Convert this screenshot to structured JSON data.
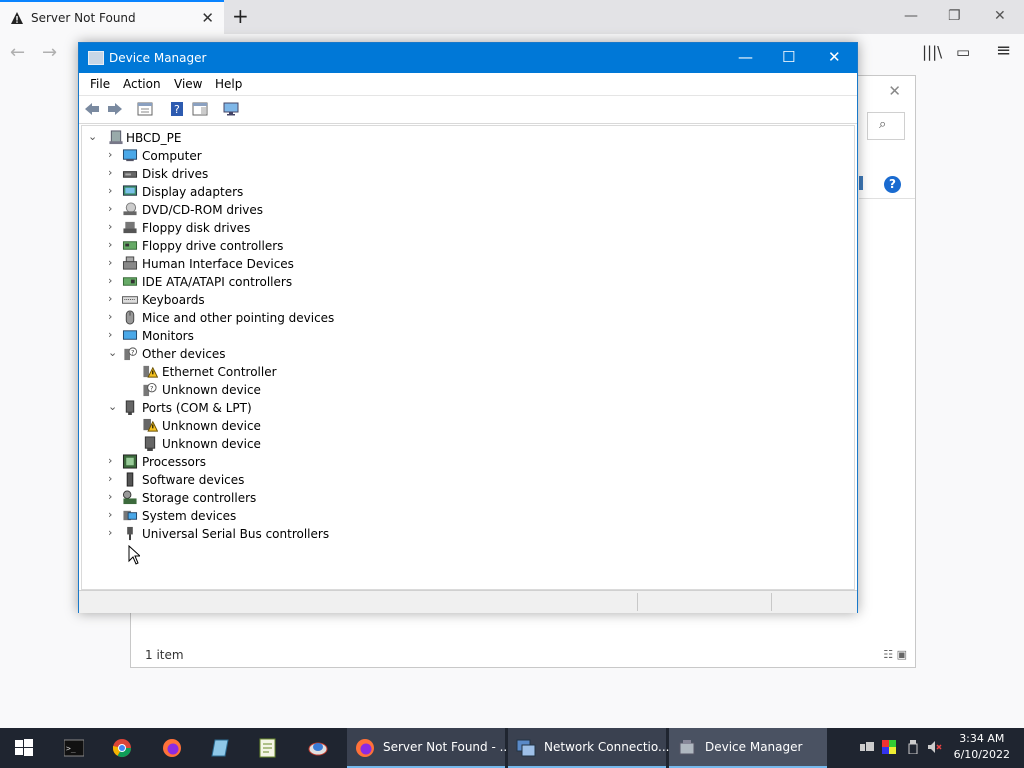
{
  "browser": {
    "tab_title": "Server Not Found",
    "tab_close": "✕",
    "new_tab": "+",
    "window_controls": {
      "minimize": "—",
      "restore": "❐",
      "close": "✕"
    },
    "nav": {
      "back": "←",
      "forward": "→"
    },
    "toolbar": {
      "library": "|||\\",
      "sidebar": "▭",
      "menu": "≡"
    }
  },
  "network_window": {
    "close": "✕",
    "search_icon": "⌕",
    "help": "?",
    "status_text": "1 item",
    "view_buttons": "☷ ▣"
  },
  "device_manager": {
    "title": "Device Manager",
    "controls": {
      "minimize": "—",
      "maximize": "☐",
      "close": "✕"
    },
    "menu": [
      "File",
      "Action",
      "View",
      "Help"
    ],
    "tree": {
      "root": "HBCD_PE",
      "categories": [
        {
          "label": "Computer",
          "icon": "computer-icon",
          "expanded": false
        },
        {
          "label": "Disk drives",
          "icon": "disk-drive-icon",
          "expanded": false
        },
        {
          "label": "Display adapters",
          "icon": "display-adapter-icon",
          "expanded": false
        },
        {
          "label": "DVD/CD-ROM drives",
          "icon": "dvd-drive-icon",
          "expanded": false
        },
        {
          "label": "Floppy disk drives",
          "icon": "floppy-drive-icon",
          "expanded": false
        },
        {
          "label": "Floppy drive controllers",
          "icon": "floppy-controller-icon",
          "expanded": false
        },
        {
          "label": "Human Interface Devices",
          "icon": "hid-icon",
          "expanded": false
        },
        {
          "label": "IDE ATA/ATAPI controllers",
          "icon": "ide-controller-icon",
          "expanded": false
        },
        {
          "label": "Keyboards",
          "icon": "keyboard-icon",
          "expanded": false
        },
        {
          "label": "Mice and other pointing devices",
          "icon": "mouse-icon",
          "expanded": false
        },
        {
          "label": "Monitors",
          "icon": "monitor-icon",
          "expanded": false
        },
        {
          "label": "Other devices",
          "icon": "other-devices-icon",
          "expanded": true,
          "children": [
            {
              "label": "Ethernet Controller",
              "icon": "warning-device-icon"
            },
            {
              "label": "Unknown device",
              "icon": "unknown-device-icon"
            }
          ]
        },
        {
          "label": "Ports (COM & LPT)",
          "icon": "port-icon",
          "expanded": true,
          "children": [
            {
              "label": "Unknown device",
              "icon": "warning-port-icon"
            },
            {
              "label": "Unknown device",
              "icon": "port-device-icon"
            }
          ]
        },
        {
          "label": "Processors",
          "icon": "processor-icon",
          "expanded": false
        },
        {
          "label": "Software devices",
          "icon": "software-device-icon",
          "expanded": false
        },
        {
          "label": "Storage controllers",
          "icon": "storage-controller-icon",
          "expanded": false
        },
        {
          "label": "System devices",
          "icon": "system-devices-icon",
          "expanded": false
        },
        {
          "label": "Universal Serial Bus controllers",
          "icon": "usb-icon",
          "expanded": false
        }
      ]
    }
  },
  "taskbar": {
    "pinned": [
      "start-icon",
      "cmd-icon",
      "chrome-icon",
      "firefox-icon",
      "notepad-icon",
      "editor-icon",
      "disk-tool-icon"
    ],
    "tasks": [
      {
        "label": "Server Not Found - ...",
        "icon": "firefox-icon",
        "active": false
      },
      {
        "label": "Network Connectio...",
        "icon": "network-connections-icon",
        "active": false
      },
      {
        "label": "Device Manager",
        "icon": "device-manager-icon",
        "active": true
      }
    ],
    "time": "3:34 AM",
    "date": "6/10/2022"
  },
  "colors": {
    "titlebar": "#0078d7",
    "taskbar": "#1f2530",
    "accent": "#0a84ff"
  }
}
